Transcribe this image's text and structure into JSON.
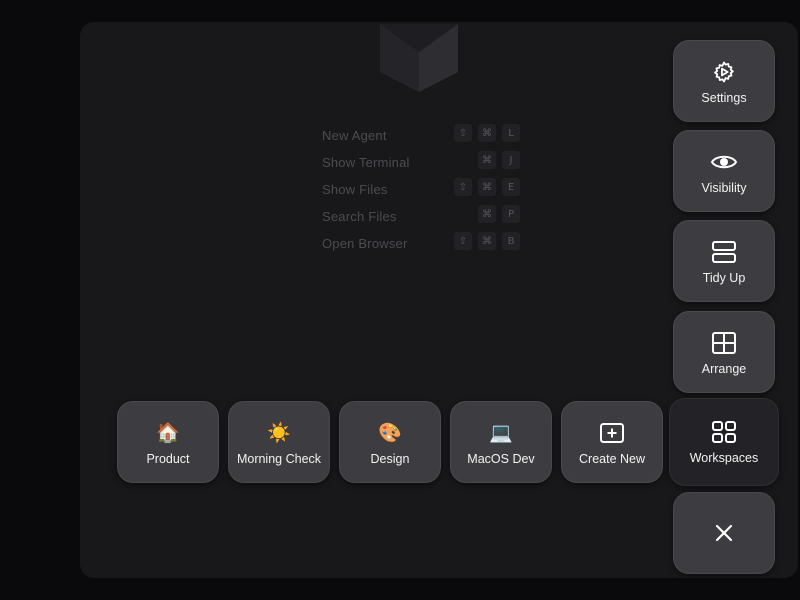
{
  "shortcuts": [
    {
      "label": "New Agent",
      "keys": [
        "⇧",
        "⌘",
        "L"
      ]
    },
    {
      "label": "Show Terminal",
      "keys": [
        "⌘",
        "J"
      ]
    },
    {
      "label": "Show Files",
      "keys": [
        "⇧",
        "⌘",
        "E"
      ]
    },
    {
      "label": "Search Files",
      "keys": [
        "⌘",
        "P"
      ]
    },
    {
      "label": "Open Browser",
      "keys": [
        "⇧",
        "⌘",
        "B"
      ]
    }
  ],
  "side_menu": {
    "settings": {
      "label": "Settings",
      "icon": "gear-icon"
    },
    "visibility": {
      "label": "Visibility",
      "icon": "eye-icon"
    },
    "tidy_up": {
      "label": "Tidy Up",
      "icon": "stacked-rows-icon"
    },
    "arrange": {
      "label": "Arrange",
      "icon": "grid-icon"
    },
    "workspaces": {
      "label": "Workspaces",
      "icon": "four-squares-icon"
    },
    "close": {
      "icon": "close-icon"
    }
  },
  "workspaces": [
    {
      "label": "Product",
      "emoji": "🏠",
      "icon": "house-emoji-icon"
    },
    {
      "label": "Morning Check",
      "emoji": "☀️",
      "icon": "sun-emoji-icon"
    },
    {
      "label": "Design",
      "emoji": "🎨",
      "icon": "palette-emoji-icon"
    },
    {
      "label": "MacOS Dev",
      "emoji": "💻",
      "icon": "laptop-emoji-icon"
    }
  ],
  "create_new": {
    "label": "Create New",
    "icon": "plus-square-icon"
  },
  "colors": {
    "panel": "#18171a",
    "tile": "#3d3c40",
    "tile_active": "#232226",
    "text": "#ffffff",
    "shortcut_text": "#4d4b50"
  }
}
